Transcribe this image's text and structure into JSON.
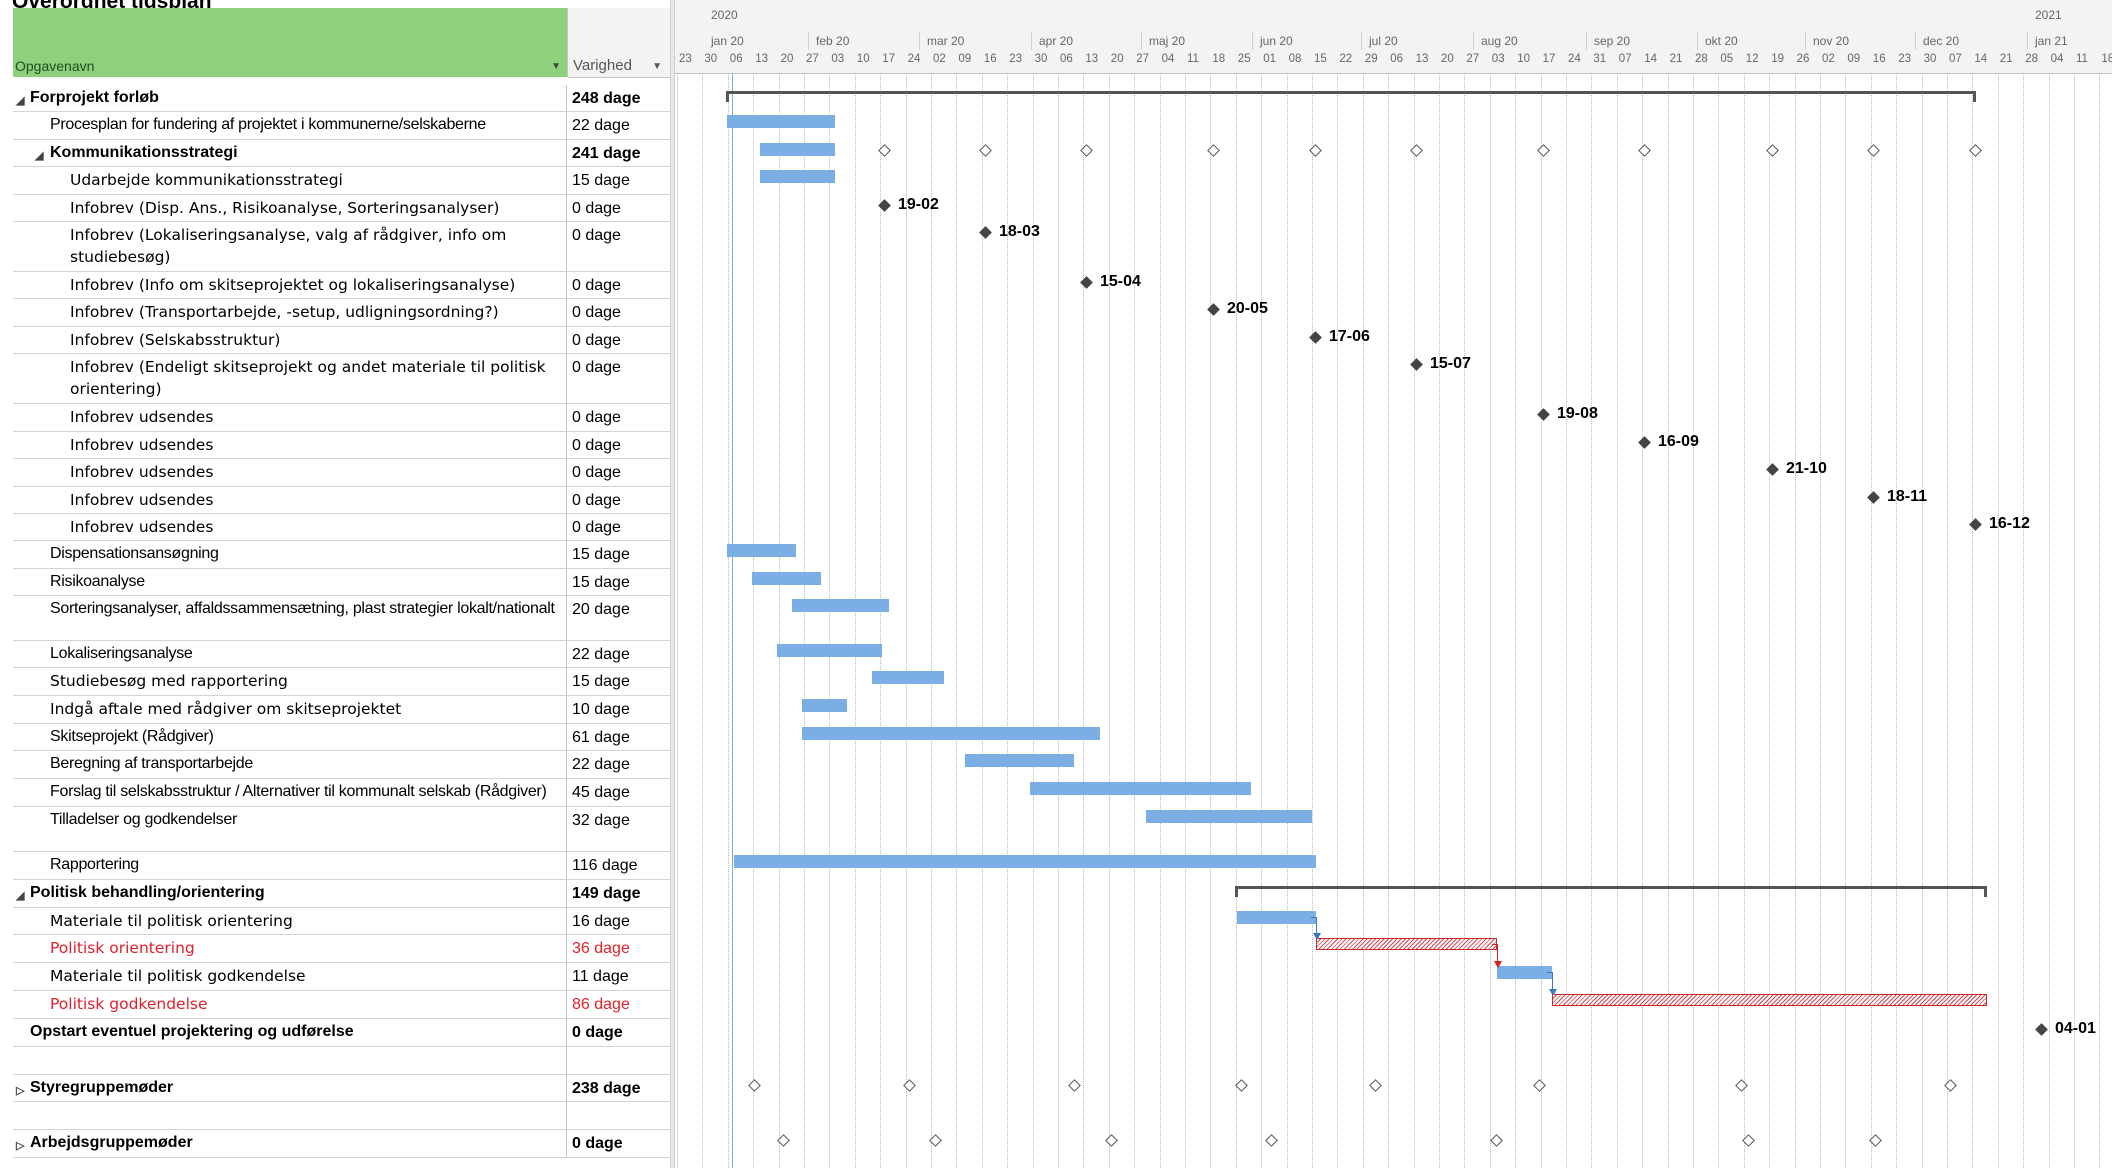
{
  "title": "Overordnet tidsplan",
  "columns": {
    "name": "Opgavenavn",
    "duration": "Varighed"
  },
  "timescale": {
    "years": [
      "2020",
      "2021"
    ],
    "months": [
      "jan 20",
      "feb 20",
      "mar 20",
      "apr 20",
      "maj 20",
      "jun 20",
      "jul 20",
      "aug 20",
      "sep 20",
      "okt 20",
      "nov 20",
      "dec 20",
      "jan 21"
    ],
    "days": [
      "23",
      "30",
      "06",
      "13",
      "20",
      "27",
      "03",
      "10",
      "17",
      "24",
      "02",
      "09",
      "16",
      "23",
      "30",
      "06",
      "13",
      "20",
      "27",
      "04",
      "11",
      "18",
      "25",
      "01",
      "08",
      "15",
      "22",
      "29",
      "06",
      "13",
      "20",
      "27",
      "03",
      "10",
      "17",
      "24",
      "31",
      "07",
      "14",
      "21",
      "28",
      "05",
      "12",
      "19",
      "26",
      "02",
      "09",
      "16",
      "23",
      "30",
      "07",
      "14",
      "21",
      "28",
      "04",
      "11",
      "18"
    ]
  },
  "tasks": [
    {
      "name": "Forprojekt forløb",
      "duration": "248 dage",
      "level": 0,
      "summary": true,
      "expanded": true
    },
    {
      "name": "Procesplan for fundering af projektet i kommunerne/selskaberne",
      "duration": "22 dage",
      "level": 1
    },
    {
      "name": "Kommunikationsstrategi",
      "duration": "241 dage",
      "level": 1,
      "summary": true,
      "expanded": true
    },
    {
      "name": "Udarbejde kommunikationsstrategi",
      "duration": "15 dage",
      "level": 2
    },
    {
      "name": "Infobrev (Disp. Ans., Risikoanalyse, Sorteringsanalyser)",
      "duration": "0 dage",
      "level": 2
    },
    {
      "name": "Infobrev (Lokaliseringsanalyse, valg af rådgiver, info om studiebesøg)",
      "duration": "0 dage",
      "level": 2
    },
    {
      "name": "Infobrev (Info om skitseprojektet og lokaliseringsanalyse)",
      "duration": "0 dage",
      "level": 2
    },
    {
      "name": "Infobrev (Transportarbejde, -setup, udligningsordning?)",
      "duration": "0 dage",
      "level": 2
    },
    {
      "name": "Infobrev (Selskabsstruktur)",
      "duration": "0 dage",
      "level": 2
    },
    {
      "name": "Infobrev (Endeligt skitseprojekt og andet materiale til politisk orientering)",
      "duration": "0 dage",
      "level": 2
    },
    {
      "name": "Infobrev udsendes",
      "duration": "0 dage",
      "level": 2
    },
    {
      "name": "Infobrev udsendes",
      "duration": "0 dage",
      "level": 2
    },
    {
      "name": "Infobrev udsendes",
      "duration": "0 dage",
      "level": 2
    },
    {
      "name": "Infobrev udsendes",
      "duration": "0 dage",
      "level": 2
    },
    {
      "name": "Infobrev udsendes",
      "duration": "0 dage",
      "level": 2
    },
    {
      "name": "Dispensationsansøgning",
      "duration": "15 dage",
      "level": 1
    },
    {
      "name": "Risikoanalyse",
      "duration": "15 dage",
      "level": 1
    },
    {
      "name": "Sorteringsanalyser, affaldssammensætning, plast strategier lokalt/nationalt",
      "duration": "20 dage",
      "level": 1
    },
    {
      "name": "Lokaliseringsanalyse",
      "duration": "22 dage",
      "level": 1
    },
    {
      "name": "Studiebesøg med rapportering",
      "duration": "15 dage",
      "level": 1
    },
    {
      "name": "Indgå aftale med rådgiver om skitseprojektet",
      "duration": "10 dage",
      "level": 1
    },
    {
      "name": "Skitseprojekt (Rådgiver)",
      "duration": "61 dage",
      "level": 1
    },
    {
      "name": "Beregning af transportarbejde",
      "duration": "22 dage",
      "level": 1
    },
    {
      "name": "Forslag til selskabsstruktur / Alternativer til kommunalt selskab (Rådgiver)",
      "duration": "45 dage",
      "level": 1
    },
    {
      "name": "Tilladelser og godkendelser",
      "duration": "32 dage",
      "level": 1
    },
    {
      "name": "Rapportering",
      "duration": "116 dage",
      "level": 1
    },
    {
      "name": "Politisk behandling/orientering",
      "duration": "149 dage",
      "level": 0,
      "summary": true,
      "expanded": true
    },
    {
      "name": "Materiale til politisk orientering",
      "duration": "16 dage",
      "level": 1
    },
    {
      "name": "Politisk orientering",
      "duration": "36 dage",
      "level": 1,
      "critical": true
    },
    {
      "name": "Materiale til politisk godkendelse",
      "duration": "11 dage",
      "level": 1
    },
    {
      "name": "Politisk godkendelse",
      "duration": "86 dage",
      "level": 1,
      "critical": true
    },
    {
      "name": "Opstart eventuel projektering og udførelse",
      "duration": "0 dage",
      "level": 0,
      "bold": true
    },
    {
      "name": "",
      "duration": "",
      "level": 0
    },
    {
      "name": "Styregruppemøder",
      "duration": "238 dage",
      "level": 0,
      "summary": true,
      "expanded": false
    },
    {
      "name": "",
      "duration": "",
      "level": 0
    },
    {
      "name": "Arbejdsgruppemøder",
      "duration": "0 dage",
      "level": 0,
      "summary": true,
      "expanded": false
    }
  ],
  "milestone_labels": [
    "19-02",
    "18-03",
    "15-04",
    "20-05",
    "17-06",
    "15-07",
    "19-08",
    "16-09",
    "21-10",
    "18-11",
    "16-12",
    "04-01"
  ],
  "colors": {
    "column_header": "#8ed07c",
    "task_bar": "#7aaee4",
    "critical": "#d21f28",
    "critical_text": "#e0202a"
  }
}
